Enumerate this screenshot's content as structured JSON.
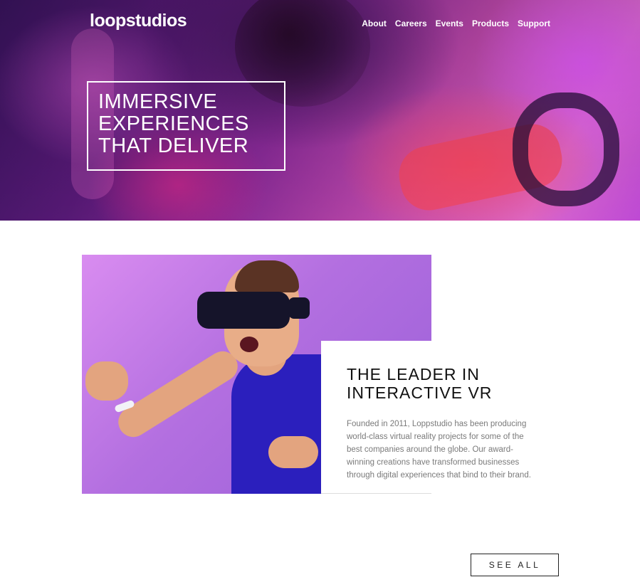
{
  "header": {
    "logo": "loopstudios",
    "nav": [
      "About",
      "Careers",
      "Events",
      "Products",
      "Support"
    ]
  },
  "hero": {
    "headline_lines": [
      "IMMERSIVE",
      "EXPERIENCES",
      "THAT DELIVER"
    ]
  },
  "feature": {
    "title_lines": [
      "THE LEADER IN",
      "INTERACTIVE VR"
    ],
    "body": "Founded in 2011, Loppstudio has been producing world-class virtual reality projects for some of the best companies around the globe. Our award-winning creations have transformed businesses through digital experiences that bind to their brand."
  },
  "actions": {
    "see_all": "SEE ALL"
  },
  "colors": {
    "accent_text": "#111111",
    "body_text": "#7a7a7a",
    "hero_purple": "#8a2a9a",
    "hero_pink": "#e66fd8"
  }
}
